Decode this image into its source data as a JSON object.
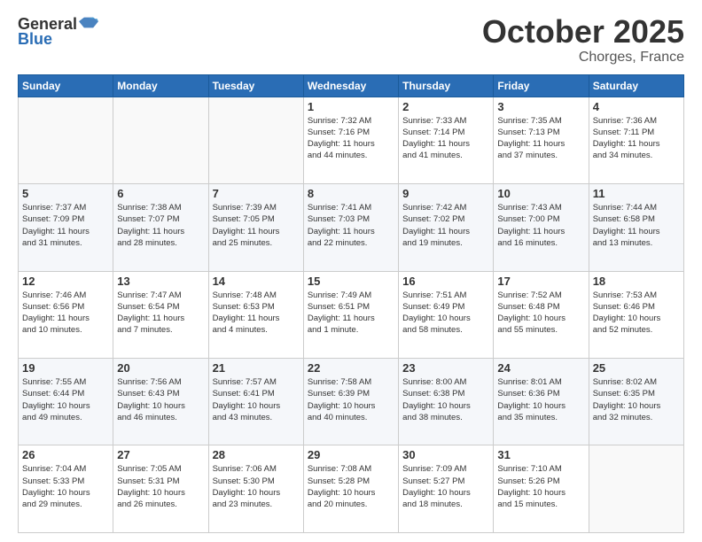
{
  "header": {
    "logo_general": "General",
    "logo_blue": "Blue",
    "month": "October 2025",
    "location": "Chorges, France"
  },
  "weekdays": [
    "Sunday",
    "Monday",
    "Tuesday",
    "Wednesday",
    "Thursday",
    "Friday",
    "Saturday"
  ],
  "weeks": [
    [
      {
        "day": "",
        "info": ""
      },
      {
        "day": "",
        "info": ""
      },
      {
        "day": "",
        "info": ""
      },
      {
        "day": "1",
        "info": "Sunrise: 7:32 AM\nSunset: 7:16 PM\nDaylight: 11 hours\nand 44 minutes."
      },
      {
        "day": "2",
        "info": "Sunrise: 7:33 AM\nSunset: 7:14 PM\nDaylight: 11 hours\nand 41 minutes."
      },
      {
        "day": "3",
        "info": "Sunrise: 7:35 AM\nSunset: 7:13 PM\nDaylight: 11 hours\nand 37 minutes."
      },
      {
        "day": "4",
        "info": "Sunrise: 7:36 AM\nSunset: 7:11 PM\nDaylight: 11 hours\nand 34 minutes."
      }
    ],
    [
      {
        "day": "5",
        "info": "Sunrise: 7:37 AM\nSunset: 7:09 PM\nDaylight: 11 hours\nand 31 minutes."
      },
      {
        "day": "6",
        "info": "Sunrise: 7:38 AM\nSunset: 7:07 PM\nDaylight: 11 hours\nand 28 minutes."
      },
      {
        "day": "7",
        "info": "Sunrise: 7:39 AM\nSunset: 7:05 PM\nDaylight: 11 hours\nand 25 minutes."
      },
      {
        "day": "8",
        "info": "Sunrise: 7:41 AM\nSunset: 7:03 PM\nDaylight: 11 hours\nand 22 minutes."
      },
      {
        "day": "9",
        "info": "Sunrise: 7:42 AM\nSunset: 7:02 PM\nDaylight: 11 hours\nand 19 minutes."
      },
      {
        "day": "10",
        "info": "Sunrise: 7:43 AM\nSunset: 7:00 PM\nDaylight: 11 hours\nand 16 minutes."
      },
      {
        "day": "11",
        "info": "Sunrise: 7:44 AM\nSunset: 6:58 PM\nDaylight: 11 hours\nand 13 minutes."
      }
    ],
    [
      {
        "day": "12",
        "info": "Sunrise: 7:46 AM\nSunset: 6:56 PM\nDaylight: 11 hours\nand 10 minutes."
      },
      {
        "day": "13",
        "info": "Sunrise: 7:47 AM\nSunset: 6:54 PM\nDaylight: 11 hours\nand 7 minutes."
      },
      {
        "day": "14",
        "info": "Sunrise: 7:48 AM\nSunset: 6:53 PM\nDaylight: 11 hours\nand 4 minutes."
      },
      {
        "day": "15",
        "info": "Sunrise: 7:49 AM\nSunset: 6:51 PM\nDaylight: 11 hours\nand 1 minute."
      },
      {
        "day": "16",
        "info": "Sunrise: 7:51 AM\nSunset: 6:49 PM\nDaylight: 10 hours\nand 58 minutes."
      },
      {
        "day": "17",
        "info": "Sunrise: 7:52 AM\nSunset: 6:48 PM\nDaylight: 10 hours\nand 55 minutes."
      },
      {
        "day": "18",
        "info": "Sunrise: 7:53 AM\nSunset: 6:46 PM\nDaylight: 10 hours\nand 52 minutes."
      }
    ],
    [
      {
        "day": "19",
        "info": "Sunrise: 7:55 AM\nSunset: 6:44 PM\nDaylight: 10 hours\nand 49 minutes."
      },
      {
        "day": "20",
        "info": "Sunrise: 7:56 AM\nSunset: 6:43 PM\nDaylight: 10 hours\nand 46 minutes."
      },
      {
        "day": "21",
        "info": "Sunrise: 7:57 AM\nSunset: 6:41 PM\nDaylight: 10 hours\nand 43 minutes."
      },
      {
        "day": "22",
        "info": "Sunrise: 7:58 AM\nSunset: 6:39 PM\nDaylight: 10 hours\nand 40 minutes."
      },
      {
        "day": "23",
        "info": "Sunrise: 8:00 AM\nSunset: 6:38 PM\nDaylight: 10 hours\nand 38 minutes."
      },
      {
        "day": "24",
        "info": "Sunrise: 8:01 AM\nSunset: 6:36 PM\nDaylight: 10 hours\nand 35 minutes."
      },
      {
        "day": "25",
        "info": "Sunrise: 8:02 AM\nSunset: 6:35 PM\nDaylight: 10 hours\nand 32 minutes."
      }
    ],
    [
      {
        "day": "26",
        "info": "Sunrise: 7:04 AM\nSunset: 5:33 PM\nDaylight: 10 hours\nand 29 minutes."
      },
      {
        "day": "27",
        "info": "Sunrise: 7:05 AM\nSunset: 5:31 PM\nDaylight: 10 hours\nand 26 minutes."
      },
      {
        "day": "28",
        "info": "Sunrise: 7:06 AM\nSunset: 5:30 PM\nDaylight: 10 hours\nand 23 minutes."
      },
      {
        "day": "29",
        "info": "Sunrise: 7:08 AM\nSunset: 5:28 PM\nDaylight: 10 hours\nand 20 minutes."
      },
      {
        "day": "30",
        "info": "Sunrise: 7:09 AM\nSunset: 5:27 PM\nDaylight: 10 hours\nand 18 minutes."
      },
      {
        "day": "31",
        "info": "Sunrise: 7:10 AM\nSunset: 5:26 PM\nDaylight: 10 hours\nand 15 minutes."
      },
      {
        "day": "",
        "info": ""
      }
    ]
  ]
}
